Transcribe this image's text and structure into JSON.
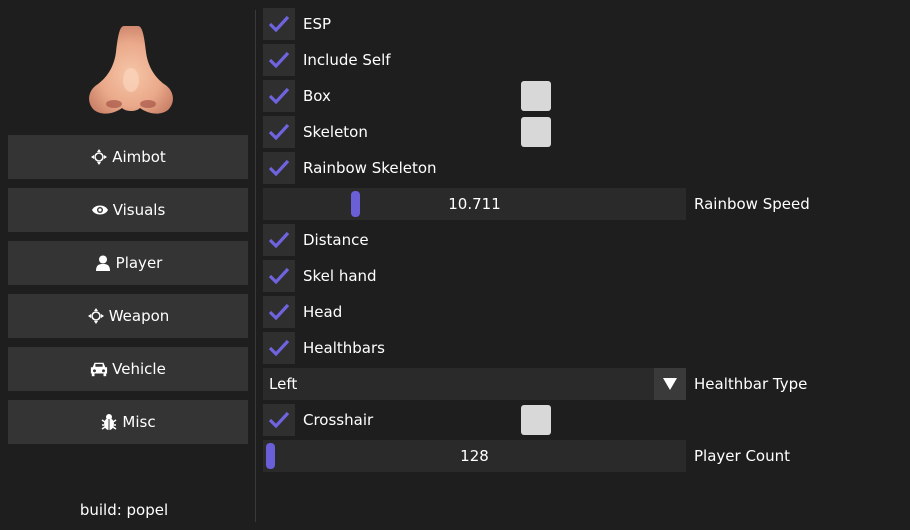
{
  "sidebar": {
    "nav": [
      {
        "label": "Aimbot",
        "icon": "crosshair-arrows-icon"
      },
      {
        "label": "Visuals",
        "icon": "eye-icon"
      },
      {
        "label": "Player",
        "icon": "user-icon"
      },
      {
        "label": "Weapon",
        "icon": "crosshair-arrows-icon"
      },
      {
        "label": "Vehicle",
        "icon": "car-icon"
      },
      {
        "label": "Misc",
        "icon": "bug-icon"
      }
    ],
    "build": "build: popel"
  },
  "options": {
    "esp": {
      "label": "ESP",
      "checked": true
    },
    "include_self": {
      "label": "Include Self",
      "checked": true
    },
    "box": {
      "label": "Box",
      "checked": true,
      "color": "#d8d8d8"
    },
    "skeleton": {
      "label": "Skeleton",
      "checked": true,
      "color": "#d8d8d8"
    },
    "rainbow_skeleton": {
      "label": "Rainbow Skeleton",
      "checked": true
    },
    "rainbow_speed": {
      "label": "Rainbow Speed",
      "value": "10.711"
    },
    "distance": {
      "label": "Distance",
      "checked": true
    },
    "skel_hand": {
      "label": "Skel hand",
      "checked": true
    },
    "head": {
      "label": "Head",
      "checked": true
    },
    "healthbars": {
      "label": "Healthbars",
      "checked": true
    },
    "healthbar_type": {
      "label": "Healthbar Type",
      "value": "Left"
    },
    "crosshair": {
      "label": "Crosshair",
      "checked": true,
      "color": "#d8d8d8"
    },
    "player_count": {
      "label": "Player Count",
      "value": "128"
    }
  },
  "colors": {
    "accent": "#6a5fd6",
    "check": "#6f63e0",
    "background": "#1e1e1e",
    "button": "#343434"
  }
}
